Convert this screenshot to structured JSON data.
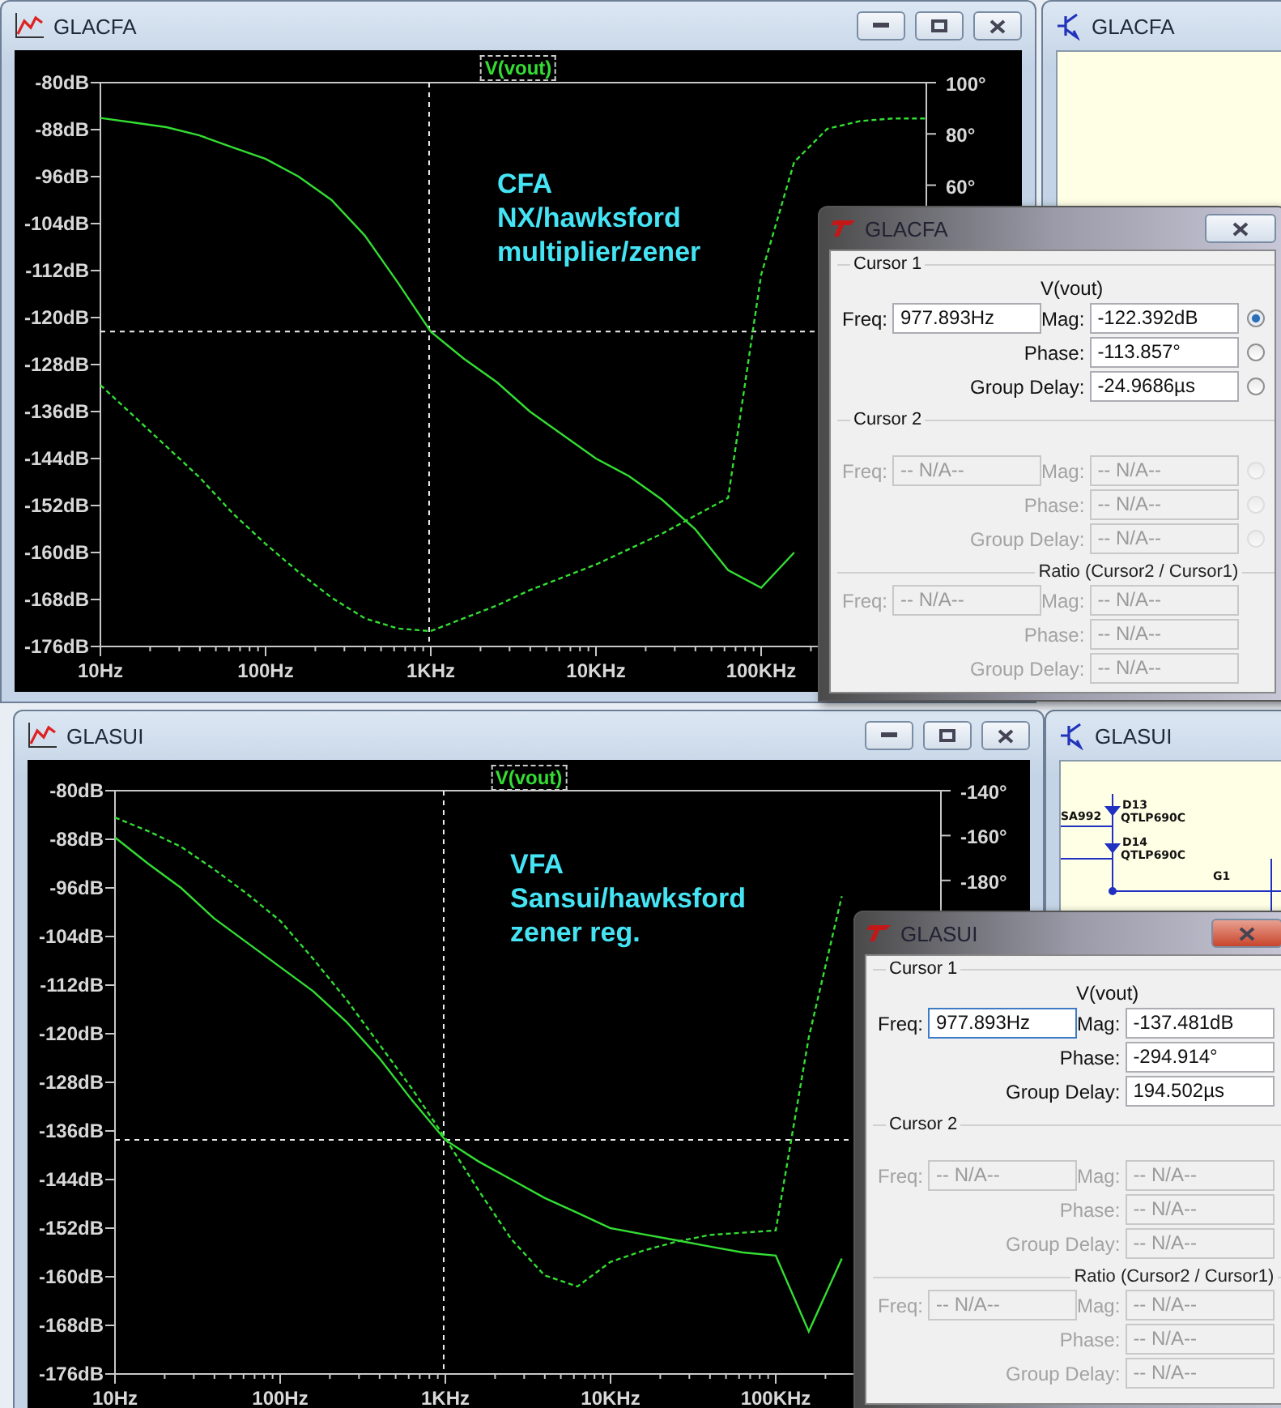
{
  "plot_windows": [
    {
      "title": "GLACFA",
      "note": [
        "CFA",
        "NX/hawksford",
        "multiplier/zener"
      ],
      "chart_data": {
        "type": "line",
        "categories": [
          "10Hz",
          null,
          null,
          null,
          null,
          "100Hz",
          null,
          null,
          null,
          null,
          "1KHz",
          null,
          null,
          null,
          null,
          "10KHz",
          null,
          null,
          null,
          null,
          "100KHz",
          null,
          null,
          null,
          null,
          null
        ],
        "series": [
          {
            "name": "V(vout)",
            "color": "#33dd33",
            "values": [
              -86,
              -86.8,
              -87.6,
              -89,
              -91,
              -93,
              -96,
              -100,
              -106,
              -114,
              -122.4,
              -127,
              -131,
              -136,
              -140,
              -144,
              -147,
              -151,
              -156,
              -163,
              -166,
              -160,
              null,
              null,
              null,
              null
            ]
          },
          {
            "color": "#33dd33",
            "axis": "y2",
            "line_style": "dashed",
            "values": [
              -18,
              -30,
              -42,
              -54,
              -68,
              -80,
              -91,
              -101,
              -109,
              -113,
              -114,
              -109,
              -104,
              -98,
              -93,
              -88,
              -82,
              -76,
              -69,
              -62,
              25,
              69,
              82,
              85,
              86,
              86
            ]
          }
        ],
        "ylim": [
          -176,
          -80
        ],
        "y2lim": [
          -120,
          100
        ],
        "yticks": [
          {
            "value": -80,
            "label": "-80dB"
          },
          {
            "value": -88,
            "label": "-88dB"
          },
          {
            "value": -96,
            "label": "-96dB"
          },
          {
            "value": -104,
            "label": "-104dB"
          },
          {
            "value": -112,
            "label": "-112dB"
          },
          {
            "value": -120,
            "label": "-120dB"
          },
          {
            "value": -128,
            "label": "-128dB"
          },
          {
            "value": -136,
            "label": "-136dB"
          },
          {
            "value": -144,
            "label": "-144dB"
          },
          {
            "value": -152,
            "label": "-152dB"
          },
          {
            "value": -160,
            "label": "-160dB"
          },
          {
            "value": -168,
            "label": "-168dB"
          },
          {
            "value": -176,
            "label": "-176dB"
          }
        ],
        "y2ticks": [
          {
            "value": 100,
            "label": "100°"
          },
          {
            "value": 80,
            "label": "80°"
          },
          {
            "value": 60,
            "label": "60°"
          }
        ],
        "ref_lines": [
          {
            "axis": "y",
            "value": -122.392
          }
        ]
      }
    },
    {
      "title": "GLASUI",
      "note": [
        "VFA",
        "Sansui/hawksford",
        "zener reg."
      ],
      "chart_data": {
        "type": "line",
        "categories": [
          "10Hz",
          null,
          null,
          null,
          null,
          "100Hz",
          null,
          null,
          null,
          null,
          "1KHz",
          null,
          null,
          null,
          null,
          "10KHz",
          null,
          null,
          null,
          null,
          "100KHz",
          null,
          null,
          null,
          null,
          null
        ],
        "series": [
          {
            "name": "V(vout)",
            "color": "#33dd33",
            "values": [
              -87.7,
              -92,
              -96,
              -101,
              -105,
              -109,
              -113,
              -118,
              -124,
              -131,
              -137.5,
              -141,
              -144,
              -147,
              -149.5,
              -152,
              -153,
              -154,
              -155,
              -156,
              -156.5,
              -169,
              -157,
              null,
              null,
              null
            ]
          },
          {
            "color": "#33dd33",
            "axis": "y2",
            "line_style": "dashed",
            "values": [
              -152,
              -158,
              -165,
              -175,
              -186,
              -198,
              -215,
              -233,
              -253,
              -273,
              -295,
              -318,
              -340,
              -356,
              -361,
              -350,
              -345,
              -341,
              -338,
              -337,
              -336,
              -250,
              -187,
              null,
              null,
              null
            ]
          }
        ],
        "ylim": [
          -176,
          -80
        ],
        "y2lim": [
          -400,
          -140
        ],
        "yticks": [
          {
            "value": -80,
            "label": "-80dB"
          },
          {
            "value": -88,
            "label": "-88dB"
          },
          {
            "value": -96,
            "label": "-96dB"
          },
          {
            "value": -104,
            "label": "-104dB"
          },
          {
            "value": -112,
            "label": "-112dB"
          },
          {
            "value": -120,
            "label": "-120dB"
          },
          {
            "value": -128,
            "label": "-128dB"
          },
          {
            "value": -136,
            "label": "-136dB"
          },
          {
            "value": -144,
            "label": "-144dB"
          },
          {
            "value": -152,
            "label": "-152dB"
          },
          {
            "value": -160,
            "label": "-160dB"
          },
          {
            "value": -168,
            "label": "-168dB"
          },
          {
            "value": -176,
            "label": "-176dB"
          }
        ],
        "y2ticks": [
          {
            "value": -140,
            "label": "-140°"
          },
          {
            "value": -160,
            "label": "-160°"
          },
          {
            "value": -180,
            "label": "-180°"
          }
        ],
        "ref_lines": [
          {
            "axis": "y",
            "value": -137.481
          }
        ]
      }
    }
  ],
  "schematic_windows": [
    {
      "title": "GLACFA"
    },
    {
      "title": "GLASUI",
      "labels": [
        "SA992",
        "D13",
        "QTLP690C",
        "D14",
        "QTLP690C",
        "G1"
      ]
    }
  ],
  "cursor_dialogs": [
    {
      "title": "GLACFA",
      "close_hot": false,
      "sections": [
        {
          "kind": "cursor",
          "title": "Cursor 1",
          "trace": "V(vout)",
          "freq": {
            "label": "Freq:",
            "value": "977.893Hz",
            "disabled": false,
            "focused": false
          },
          "readings": [
            {
              "label": "Mag:",
              "value": "-122.392dB",
              "disabled": false,
              "radio": {
                "selected": true
              }
            },
            {
              "label": "Phase:",
              "value": "-113.857°",
              "disabled": false,
              "radio": {
                "selected": false
              }
            },
            {
              "label": "Group Delay:",
              "value": "-24.9686µs",
              "disabled": false,
              "radio": {
                "selected": false
              }
            }
          ]
        },
        {
          "kind": "cursor",
          "title": "Cursor 2",
          "freq": {
            "label": "Freq:",
            "value": "-- N/A--",
            "disabled": true,
            "focused": false
          },
          "readings": [
            {
              "label": "Mag:",
              "value": "-- N/A--",
              "disabled": true,
              "radio": {
                "selected": false
              }
            },
            {
              "label": "Phase:",
              "value": "-- N/A--",
              "disabled": true,
              "radio": {
                "selected": false
              }
            },
            {
              "label": "Group Delay:",
              "value": "-- N/A--",
              "disabled": true,
              "radio": {
                "selected": false
              }
            }
          ]
        },
        {
          "kind": "ratio",
          "title": "Ratio (Cursor2 / Cursor1)",
          "freq": {
            "label": "Freq:",
            "value": "-- N/A--",
            "disabled": true,
            "focused": false
          },
          "readings": [
            {
              "label": "Mag:",
              "value": "-- N/A--",
              "disabled": true
            },
            {
              "label": "Phase:",
              "value": "-- N/A--",
              "disabled": true
            },
            {
              "label": "Group Delay:",
              "value": "-- N/A--",
              "disabled": true
            }
          ]
        }
      ]
    },
    {
      "title": "GLASUI",
      "close_hot": true,
      "sections": [
        {
          "kind": "cursor",
          "title": "Cursor 1",
          "trace": "V(vout)",
          "freq": {
            "label": "Freq:",
            "value": "977.893Hz",
            "disabled": false,
            "focused": true
          },
          "readings": [
            {
              "label": "Mag:",
              "value": "-137.481dB",
              "disabled": false
            },
            {
              "label": "Phase:",
              "value": "-294.914°",
              "disabled": false
            },
            {
              "label": "Group Delay:",
              "value": "194.502µs",
              "disabled": false
            }
          ]
        },
        {
          "kind": "cursor",
          "title": "Cursor 2",
          "freq": {
            "label": "Freq:",
            "value": "-- N/A--",
            "disabled": true,
            "focused": false
          },
          "readings": [
            {
              "label": "Mag:",
              "value": "-- N/A--",
              "disabled": true
            },
            {
              "label": "Phase:",
              "value": "-- N/A--",
              "disabled": true
            },
            {
              "label": "Group Delay:",
              "value": "-- N/A--",
              "disabled": true
            }
          ]
        },
        {
          "kind": "ratio",
          "title": "Ratio (Cursor2 / Cursor1)",
          "freq": {
            "label": "Freq:",
            "value": "-- N/A--",
            "disabled": true,
            "focused": false
          },
          "readings": [
            {
              "label": "Mag:",
              "value": "-- N/A--",
              "disabled": true
            },
            {
              "label": "Phase:",
              "value": "-- N/A--",
              "disabled": true
            },
            {
              "label": "Group Delay:",
              "value": "-- N/A--",
              "disabled": true
            }
          ]
        }
      ]
    }
  ]
}
